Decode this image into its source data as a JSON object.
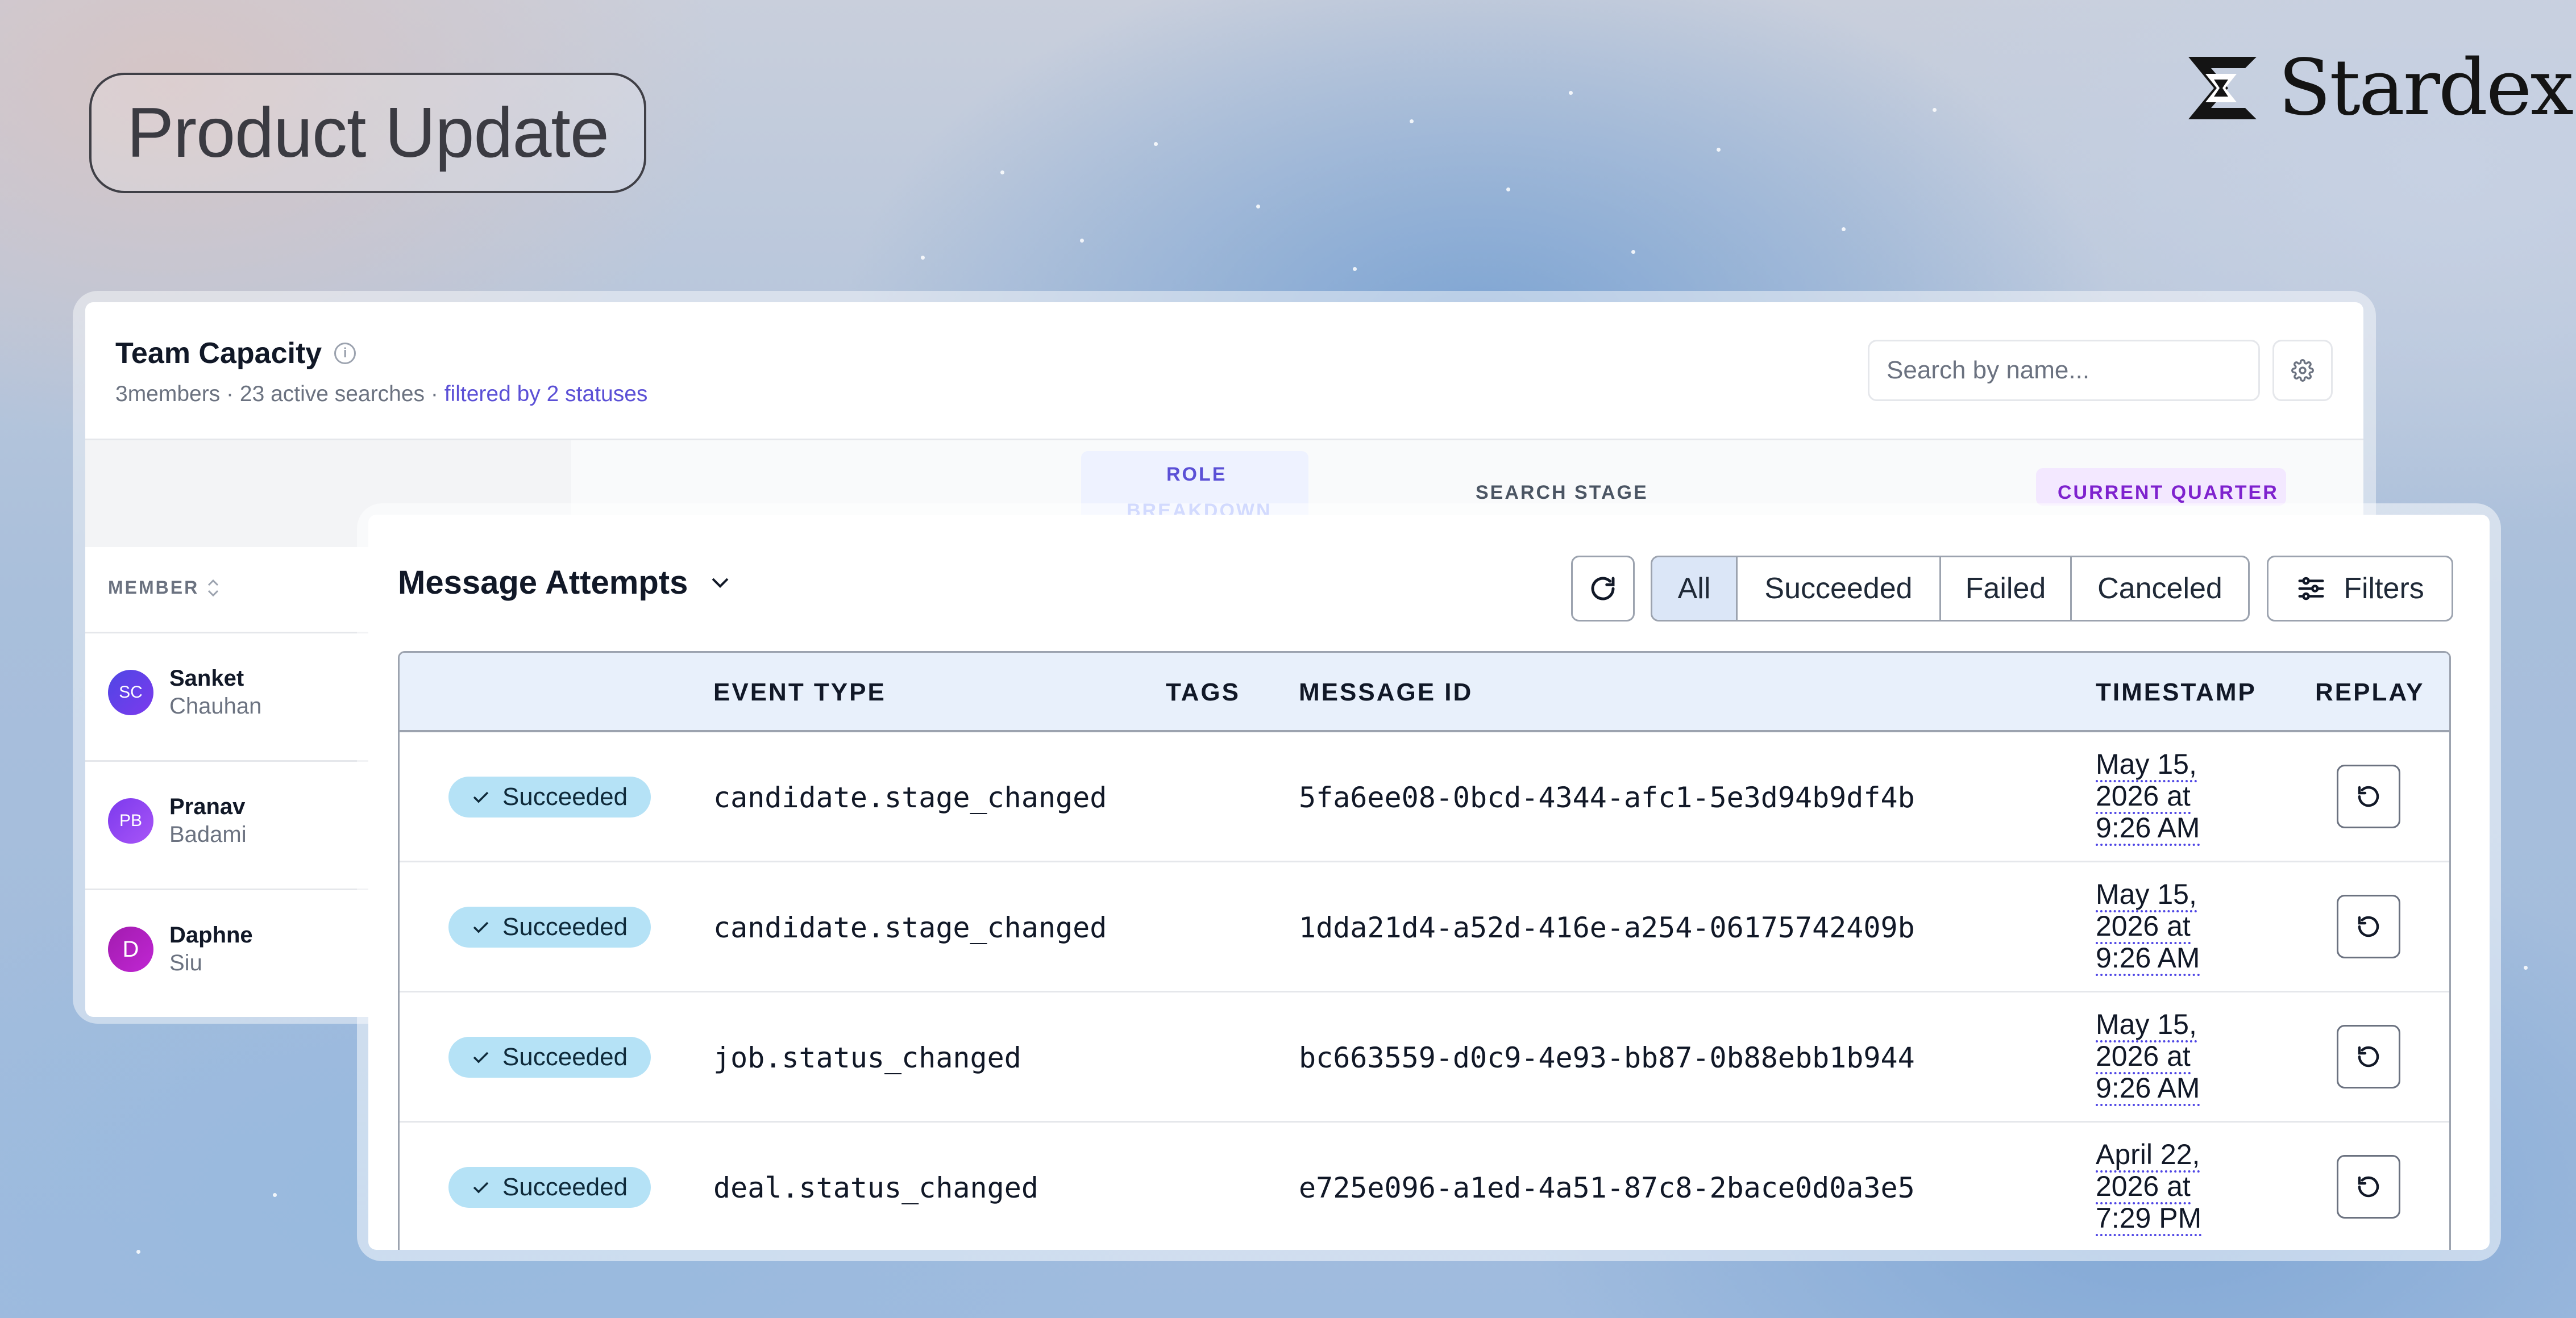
{
  "header": {
    "badge": "Product Update",
    "brand": "Stardex"
  },
  "team_capacity": {
    "title": "Team Capacity",
    "subtitle_counts": "3members · 23 active searches · ",
    "subtitle_filter": "filtered by 2 statuses",
    "search_placeholder": "Search by name...",
    "columns": {
      "role": "ROLE",
      "role_sub": "BREAKDOWN",
      "stage": "SEARCH STAGE",
      "quarter": "CURRENT QUARTER",
      "member": "MEMBER"
    },
    "members": [
      {
        "initials": "SC",
        "first": "Sanket",
        "last": "Chauhan",
        "color": "#4f46e5"
      },
      {
        "initials": "PB",
        "first": "Pranav",
        "last": "Badami",
        "color": "#7c3aed"
      },
      {
        "initials": "D",
        "first": "Daphne",
        "last": "Siu",
        "color": "#a21caf"
      }
    ]
  },
  "message_attempts": {
    "title": "Message Attempts",
    "filters": {
      "all": "All",
      "succeeded": "Succeeded",
      "failed": "Failed",
      "canceled": "Canceled"
    },
    "filters_button": "Filters",
    "columns": {
      "event_type": "EVENT TYPE",
      "tags": "TAGS",
      "message_id": "MESSAGE ID",
      "timestamp": "TIMESTAMP",
      "replay": "REPLAY"
    },
    "rows": [
      {
        "status": "Succeeded",
        "event_type": "candidate.stage_changed",
        "message_id": "5fa6ee08-0bcd-4344-afc1-5e3d94b9df4b",
        "ts1": "May 15,",
        "ts2": "2026 at",
        "ts3": "9:26 AM"
      },
      {
        "status": "Succeeded",
        "event_type": "candidate.stage_changed",
        "message_id": "1dda21d4-a52d-416e-a254-06175742409b",
        "ts1": "May 15,",
        "ts2": "2026 at",
        "ts3": "9:26 AM"
      },
      {
        "status": "Succeeded",
        "event_type": "job.status_changed",
        "message_id": "bc663559-d0c9-4e93-bb87-0b88ebb1b944",
        "ts1": "May 15,",
        "ts2": "2026 at",
        "ts3": "9:26 AM"
      },
      {
        "status": "Succeeded",
        "event_type": "deal.status_changed",
        "message_id": "e725e096-a1ed-4a51-87c8-2bace0d0a3e5",
        "ts1": "April 22,",
        "ts2": "2026 at",
        "ts3": "7:29 PM"
      }
    ]
  }
}
